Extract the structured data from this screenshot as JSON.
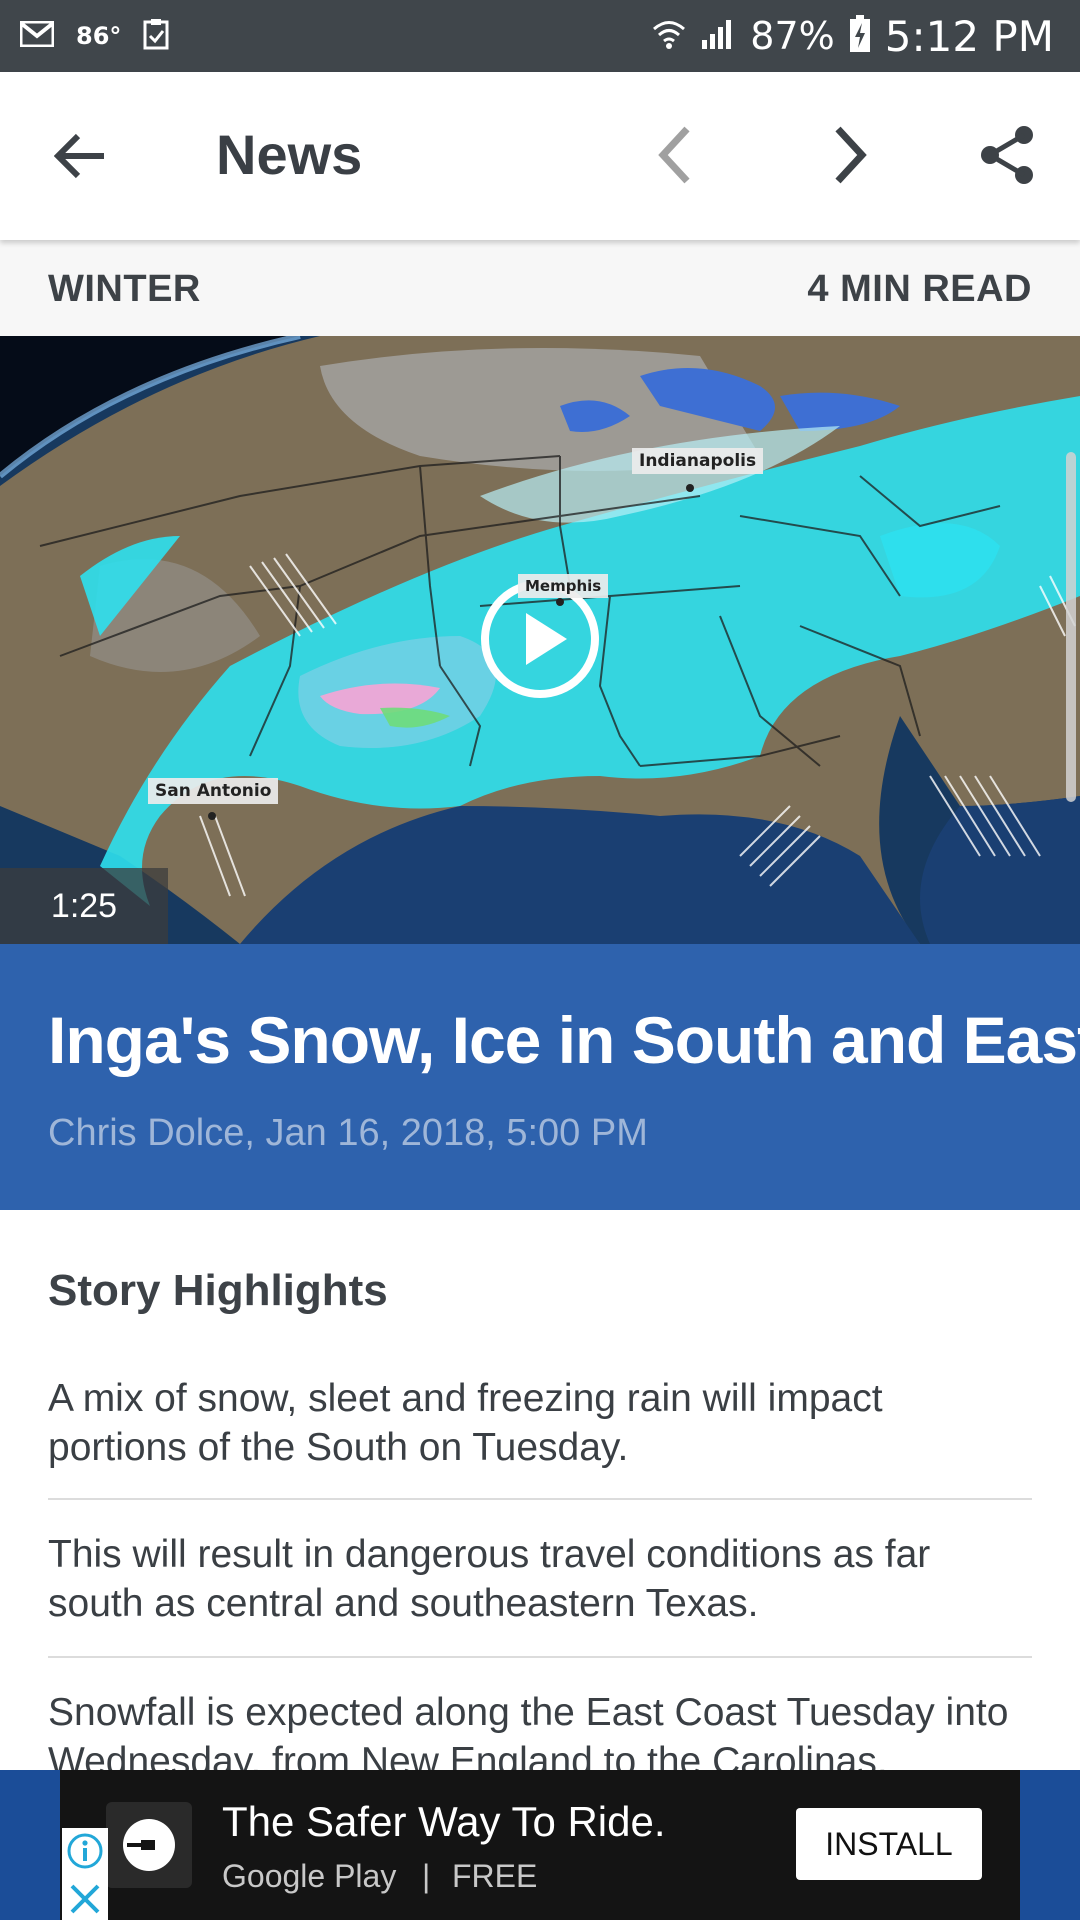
{
  "status_bar": {
    "temperature": "86°",
    "battery": "87%",
    "time": "5:12 PM"
  },
  "app_bar": {
    "title": "News"
  },
  "article_meta": {
    "category": "WINTER",
    "read_time": "4 MIN READ"
  },
  "video": {
    "duration": "1:25",
    "map_labels": [
      "Indianapolis",
      "San Antonio",
      "Memphis"
    ]
  },
  "article": {
    "headline": "Inga's Snow, Ice in South and East",
    "byline": "Chris Dolce, Jan 16, 2018, 5:00 PM"
  },
  "story_highlights": {
    "heading": "Story Highlights",
    "items": [
      "A mix of snow, sleet and freezing rain will impact portions of the South on Tuesday.",
      "This will result in dangerous travel conditions as far south as central and southeastern Texas.",
      "Snowfall is expected along the East Coast Tuesday into Wednesday, from New England to the Carolinas."
    ]
  },
  "ad": {
    "title": "The Safer Way To Ride.",
    "source": "Google Play",
    "separator": "|",
    "price": "FREE",
    "install_label": "INSTALL"
  },
  "colors": {
    "status_bar": "#40464b",
    "headline_band": "#2e62ad",
    "byline": "#9fb6d8",
    "ad_background": "#141414",
    "ad_frame": "#1b4d98"
  }
}
